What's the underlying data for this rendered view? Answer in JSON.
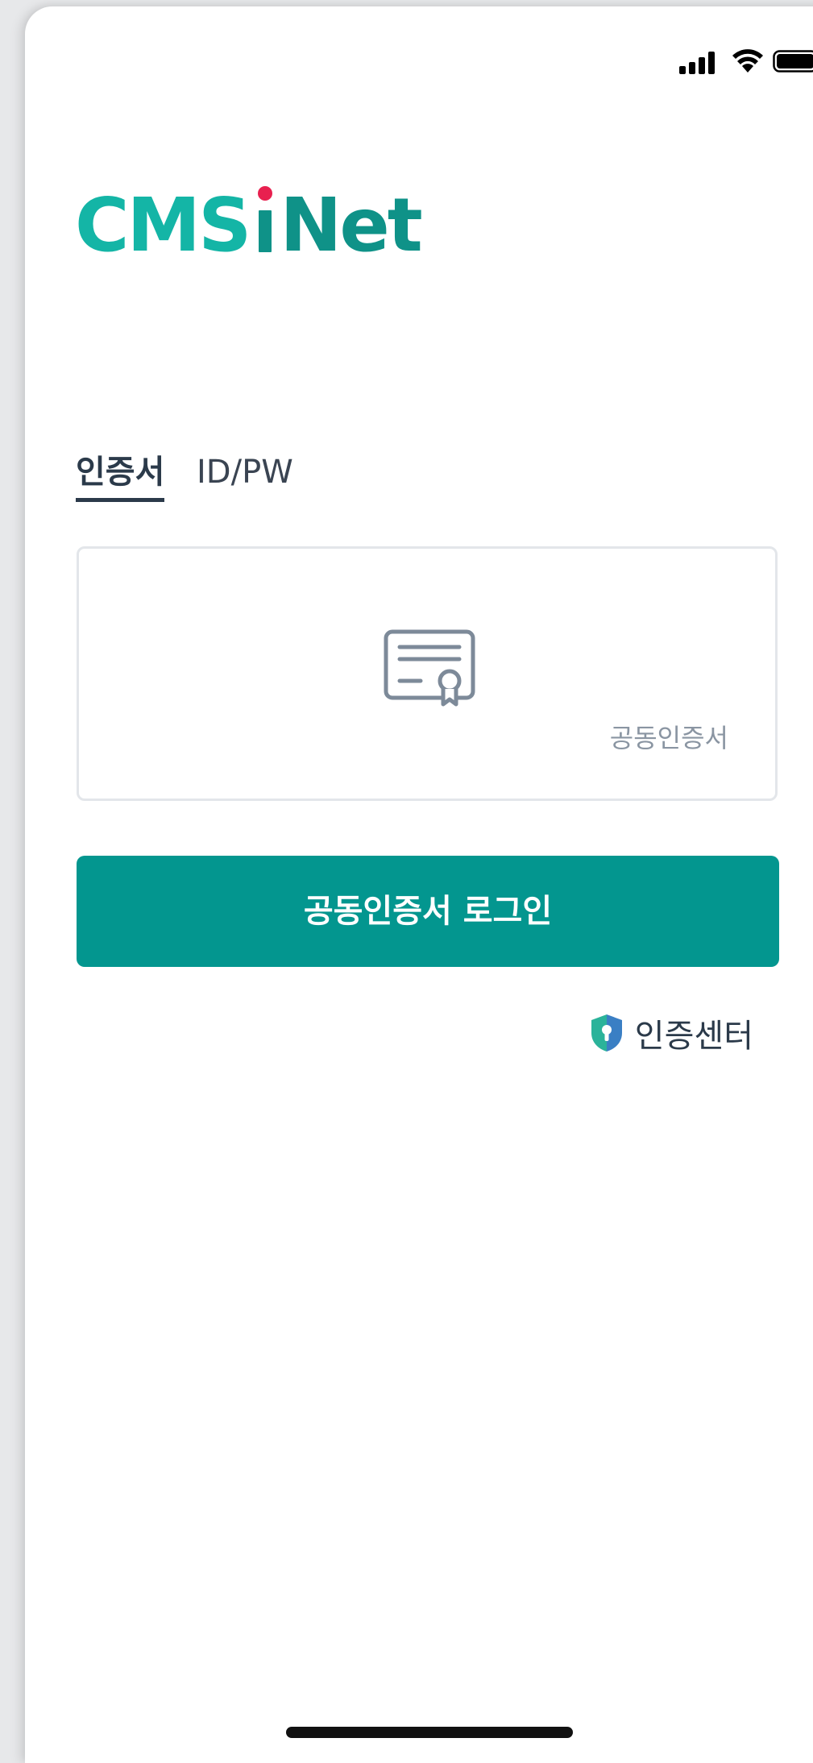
{
  "status_bar": {
    "signal_icon": "signal-bars-icon",
    "wifi_icon": "wifi-icon",
    "battery_icon": "battery-icon"
  },
  "logo": {
    "part1": "CMS",
    "part2": "i",
    "part3": "Net",
    "colors": {
      "cms": "#14b5a6",
      "net": "#0f9288",
      "dot": "#e8204f"
    }
  },
  "tabs": [
    {
      "label": "인증서",
      "active": true
    },
    {
      "label": "ID/PW",
      "active": false
    }
  ],
  "cert_card": {
    "icon": "certificate-icon",
    "label": "공동인증서"
  },
  "login_button": {
    "label": "공동인증서 로그인",
    "color": "#03968f"
  },
  "cert_center": {
    "icon": "shield-keyhole-icon",
    "label": "인증센터"
  }
}
